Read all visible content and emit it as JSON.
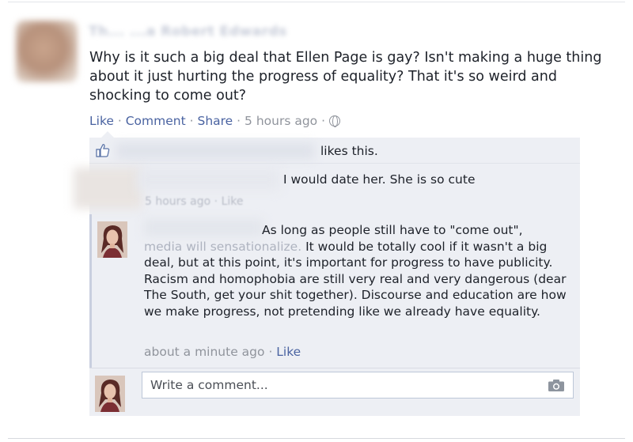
{
  "post": {
    "author_name": "Th... ...a Robert Edwards",
    "text": "Why is it such a big deal that Ellen Page is gay? Isn't making a huge thing about it just hurting the progress of equality? That it's so weird and shocking to come out?",
    "actions": {
      "like": "Like",
      "comment": "Comment",
      "share": "Share",
      "timestamp": "5 hours ago",
      "separator": "·"
    }
  },
  "likes": {
    "text": "likes this."
  },
  "comments": [
    {
      "text": "I would date her. She is so cute",
      "timestamp": "5 hours ago",
      "like": "Like"
    },
    {
      "text_lead": "As long as people still have to \"come out\",",
      "text_faded": "media will sensationalize.",
      "text_rest": "It would be totally cool if it wasn't a big deal, but at this point, it's important for progress to have publicity. Racism and homophobia are still very real and very dangerous (dear The South, get your shit together). Discourse and education are how we make progress, not pretending like we already have equality.",
      "timestamp": "about a minute ago",
      "like": "Like"
    }
  ],
  "composer": {
    "placeholder": "Write a comment..."
  },
  "icons": {
    "thumb": "thumbs-up-icon",
    "globe": "globe-icon",
    "camera": "camera-icon"
  },
  "colors": {
    "link": "#4a63a1",
    "comment_bg": "#edeff4",
    "meta": "#90949c"
  }
}
